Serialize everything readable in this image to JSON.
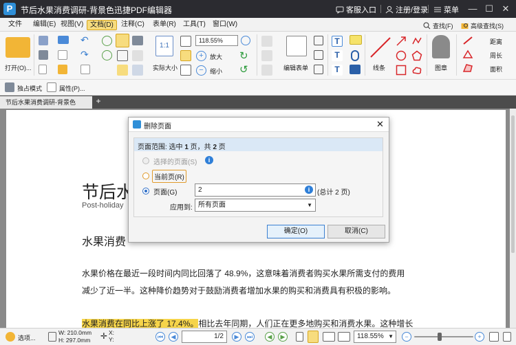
{
  "titlebar": {
    "title": "节后水果消费调研-背景色迅捷PDF编辑器",
    "service": "客服入口",
    "login": "注册/登录",
    "menu": "菜单",
    "window_controls": [
      "minimize-icon",
      "maximize-icon",
      "close-icon"
    ]
  },
  "menubar": {
    "items": [
      "文件",
      "编辑(E)",
      "视图(V)",
      "文档(D)",
      "注释(C)",
      "表单(R)",
      "工具(T)",
      "窗口(W)"
    ],
    "active": "文档(D)"
  },
  "ribbon": {
    "open_label": "打开(O)...",
    "actual_size_label": "实际大小",
    "zoom_value": "118.55%",
    "zoom_in_label": "放大",
    "zoom_out_label": "缩小",
    "edit_form_label": "编辑表单",
    "line_label": "线条",
    "stamp_label": "图章",
    "find_label": "查找(F)",
    "advanced_find_label": "高级查找(S)",
    "distance_label": "距离",
    "perimeter_label": "周长",
    "area_label": "面积",
    "accent_color": "#f7dc7e"
  },
  "modebar": {
    "exclusive_mode_label": "独占模式",
    "properties_label": "属性(P)..."
  },
  "tabs": {
    "doc_tab": "节后水果消费调研-背景色",
    "add_tab": "+"
  },
  "document": {
    "title_partial": "节后水",
    "subtitle_partial": "Post-holiday",
    "heading_partial": "水果消费",
    "para1_line1": "水果价格在最近一段时间内同比回落了  48.9%，这意味着消费者购买水果所需支付的费用",
    "para1_line2": "减少了近一半。这种降价趋势对于鼓励消费者增加水果的购买和消费具有积极的影响。",
    "para2_highlight": "水果消费在同比上涨了 17.4%。",
    "para2_rest": "相比去年同期，人们正在更多地购买和消费水果。这种增长",
    "highlight_color": "#f6d44a"
  },
  "dialog": {
    "title": "删除页面",
    "range_text_prefix": "页面范围: 选中 ",
    "range_selected": "1",
    "range_text_mid": " 页，共 ",
    "range_total": "2",
    "range_text_suffix": " 页",
    "option_selected_pages": "选择的页面(S)",
    "option_current_page": "当前页(R)",
    "option_pages": "页面(G)",
    "pages_input_value": "2",
    "total_pages_hint": "(总计 2 页)",
    "apply_to_label": "应用到:",
    "apply_to_value": "所有页面",
    "ok_label": "确定(O)",
    "cancel_label": "取消(C)",
    "selected_option": "页面(G)"
  },
  "statusbar": {
    "select_label": "选项...",
    "width_text": "W: 210.0mm",
    "height_text": "H: 297.0mm",
    "xy_text": "X:\nY:",
    "page_current": "1",
    "page_total": "/2",
    "zoom_value": "118.55%"
  }
}
